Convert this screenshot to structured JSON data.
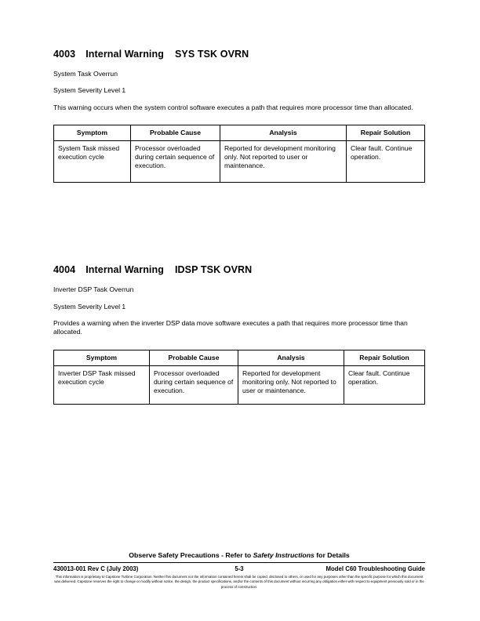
{
  "sections": [
    {
      "code": "4003",
      "type": "Internal Warning",
      "mnemonic": "SYS TSK OVRN",
      "name": "System Task Overrun",
      "severity": "System Severity Level 1",
      "description": "This warning occurs when the system control software executes a path that requires more processor time than allocated.",
      "table": {
        "headers": [
          "Symptom",
          "Probable Cause",
          "Analysis",
          "Repair Solution"
        ],
        "rows": [
          [
            "System Task missed execution cycle",
            "Processor overloaded during certain sequence of execution.",
            "Reported for development monitoring only. Not reported to user or maintenance.",
            "Clear fault. Continue operation."
          ]
        ]
      }
    },
    {
      "code": "4004",
      "type": "Internal Warning",
      "mnemonic": "IDSP TSK OVRN",
      "name": "Inverter DSP Task Overrun",
      "severity": "System Severity Level 1",
      "description": "Provides a warning when the inverter DSP data move software executes a path that requires more processor time than allocated.",
      "table": {
        "headers": [
          "Symptom",
          "Probable Cause",
          "Analysis",
          "Repair Solution"
        ],
        "rows": [
          [
            "Inverter DSP Task missed execution cycle",
            "Processor overloaded during certain sequence of execution.",
            "Reported for development monitoring only. Not reported to user or maintenance.",
            "Clear fault. Continue operation."
          ]
        ]
      }
    }
  ],
  "footer": {
    "safety_prefix": "Observe Safety Precautions - Refer to ",
    "safety_italic": "Safety Instructions",
    "safety_suffix": " for Details",
    "document_id": "430013-001 Rev C (July 2003)",
    "page_number": "5-3",
    "manual_title": "Model C60 Troubleshooting Guide",
    "legal": "This information is proprietary to Capstone Turbine Corporation. Neither this document nor the information contained herein shall be copied, disclosed to others, or used for any purposes other than the specific purpose for which this document was delivered. Capstone reserves the right to change or modify without notice, the design, the product specifications, and/or the contents of this document without incurring any obligation either with respect to equipment previously sold or in the process of construction."
  }
}
